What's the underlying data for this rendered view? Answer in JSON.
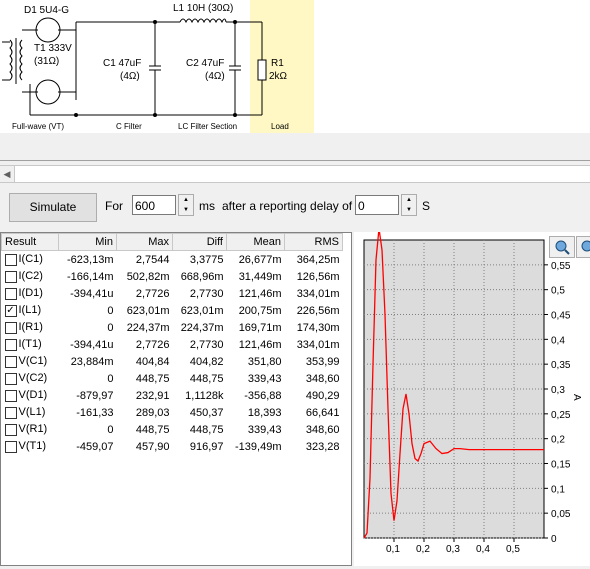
{
  "schematic": {
    "d1_label": "D1 5U4-G",
    "t1_label": "T1 333V",
    "t1_resistance": "(31Ω)",
    "l1_label": "L1 10H (30Ω)",
    "c1_label": "C1 47uF",
    "c1_resistance": "(4Ω)",
    "c2_label": "C2 47uF",
    "c2_resistance": "(4Ω)",
    "r1_label": "R1",
    "r1_value": "2kΩ",
    "section_fullwave": "Full-wave (VT)",
    "section_cfilter": "C Filter",
    "section_lcfilter": "LC Filter Section",
    "section_load": "Load"
  },
  "controls": {
    "simulate_label": "Simulate",
    "for_label": "For",
    "duration_value": "600",
    "ms_label": "ms",
    "delay_label": "after a reporting delay of",
    "delay_value": "0",
    "s_label": "S"
  },
  "table": {
    "headers": [
      "Result",
      "Min",
      "Max",
      "Diff",
      "Mean",
      "RMS"
    ],
    "rows": [
      {
        "name": "I(C1)",
        "checked": false,
        "min": "-623,13m",
        "max": "2,7544",
        "diff": "3,3775",
        "mean": "26,677m",
        "rms": "364,25m"
      },
      {
        "name": "I(C2)",
        "checked": false,
        "min": "-166,14m",
        "max": "502,82m",
        "diff": "668,96m",
        "mean": "31,449m",
        "rms": "126,56m"
      },
      {
        "name": "I(D1)",
        "checked": false,
        "min": "-394,41u",
        "max": "2,7726",
        "diff": "2,7730",
        "mean": "121,46m",
        "rms": "334,01m"
      },
      {
        "name": "I(L1)",
        "checked": true,
        "min": "0",
        "max": "623,01m",
        "diff": "623,01m",
        "mean": "200,75m",
        "rms": "226,56m"
      },
      {
        "name": "I(R1)",
        "checked": false,
        "min": "0",
        "max": "224,37m",
        "diff": "224,37m",
        "mean": "169,71m",
        "rms": "174,30m"
      },
      {
        "name": "I(T1)",
        "checked": false,
        "min": "-394,41u",
        "max": "2,7726",
        "diff": "2,7730",
        "mean": "121,46m",
        "rms": "334,01m"
      },
      {
        "name": "V(C1)",
        "checked": false,
        "min": "23,884m",
        "max": "404,84",
        "diff": "404,82",
        "mean": "351,80",
        "rms": "353,99"
      },
      {
        "name": "V(C2)",
        "checked": false,
        "min": "0",
        "max": "448,75",
        "diff": "448,75",
        "mean": "339,43",
        "rms": "348,60"
      },
      {
        "name": "V(D1)",
        "checked": false,
        "min": "-879,97",
        "max": "232,91",
        "diff": "1,1128k",
        "mean": "-356,88",
        "rms": "490,29"
      },
      {
        "name": "V(L1)",
        "checked": false,
        "min": "-161,33",
        "max": "289,03",
        "diff": "450,37",
        "mean": "18,393",
        "rms": "66,641"
      },
      {
        "name": "V(R1)",
        "checked": false,
        "min": "0",
        "max": "448,75",
        "diff": "448,75",
        "mean": "339,43",
        "rms": "348,60"
      },
      {
        "name": "V(T1)",
        "checked": false,
        "min": "-459,07",
        "max": "457,90",
        "diff": "916,97",
        "mean": "-139,49m",
        "rms": "323,28"
      }
    ]
  },
  "icons": {
    "zoom": "magnifier-icon",
    "scroll_left": "arrow-left-icon",
    "spin_up": "spin-up-icon",
    "spin_down": "spin-down-icon"
  },
  "colors": {
    "trace": "#ff0000",
    "load_bg": "#fff8c4",
    "plot_bg": "#dcdcdc",
    "grid": "#808080"
  },
  "chart_data": {
    "type": "line",
    "x_ticks": [
      "0,1",
      "0,2",
      "0,3",
      "0,4",
      "0,5"
    ],
    "y_ticks": [
      "0",
      "0,05",
      "0,1",
      "0,15",
      "0,2",
      "0,25",
      "0,3",
      "0,35",
      "0,4",
      "0,45",
      "0,5",
      "0,55"
    ],
    "ylabel": "A",
    "xlim": [
      0,
      0.6
    ],
    "ylim": [
      0,
      0.6
    ],
    "series": [
      {
        "color": "#ff0000",
        "x": [
          0,
          0.01,
          0.02,
          0.03,
          0.04,
          0.05,
          0.06,
          0.07,
          0.08,
          0.09,
          0.1,
          0.11,
          0.12,
          0.13,
          0.14,
          0.15,
          0.16,
          0.17,
          0.18,
          0.19,
          0.2,
          0.22,
          0.24,
          0.26,
          0.28,
          0.3,
          0.32,
          0.35,
          0.4,
          0.45,
          0.5,
          0.55,
          0.6
        ],
        "y": [
          0,
          0.01,
          0.12,
          0.35,
          0.56,
          0.623,
          0.58,
          0.45,
          0.26,
          0.09,
          0.035,
          0.075,
          0.17,
          0.26,
          0.29,
          0.25,
          0.19,
          0.16,
          0.155,
          0.17,
          0.19,
          0.195,
          0.18,
          0.17,
          0.172,
          0.18,
          0.18,
          0.178,
          0.178,
          0.178,
          0.178,
          0.178,
          0.178
        ]
      }
    ]
  }
}
